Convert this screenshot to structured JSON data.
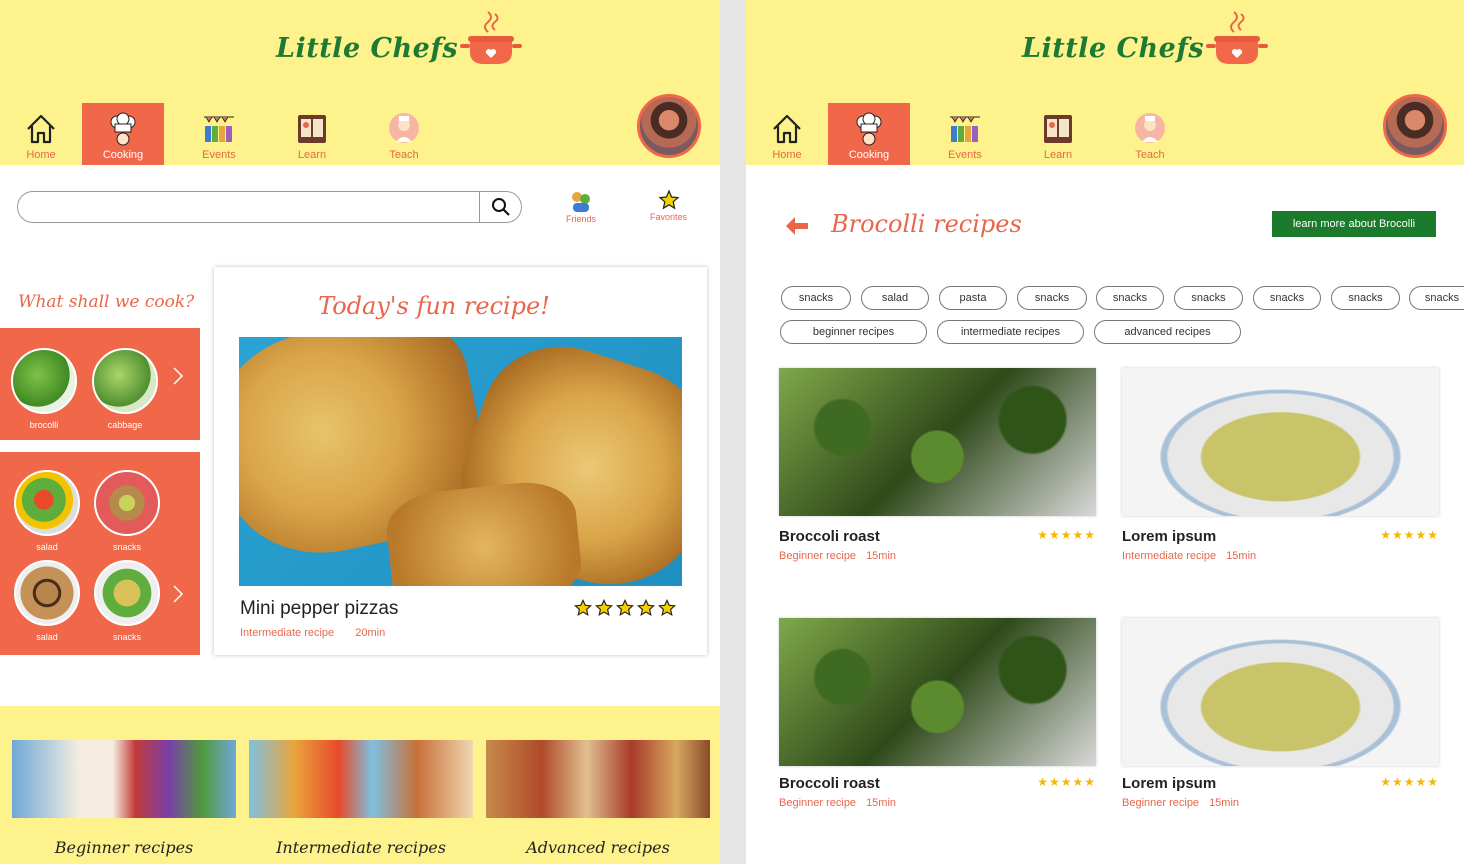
{
  "app": {
    "logo_text": "Little Chefs"
  },
  "nav": {
    "items": [
      {
        "label": "Home",
        "icon": "home-icon"
      },
      {
        "label": "Cooking",
        "icon": "chef-hat-icon",
        "active": true
      },
      {
        "label": "Events",
        "icon": "events-icon"
      },
      {
        "label": "Learn",
        "icon": "book-icon"
      },
      {
        "label": "Teach",
        "icon": "teacher-icon"
      }
    ]
  },
  "left": {
    "search": {
      "placeholder": ""
    },
    "friends_label": "Friends",
    "favorites_label": "Favorites",
    "what_cook": "What shall we cook?",
    "veg": [
      {
        "label": "brocolli"
      },
      {
        "label": "cabbage"
      }
    ],
    "dishes": [
      {
        "label": "salad"
      },
      {
        "label": "snacks"
      },
      {
        "label": "salad"
      },
      {
        "label": "snacks"
      }
    ],
    "today": {
      "title": "Today's fun recipe!",
      "recipe_name": "Mini pepper pizzas",
      "level": "Intermediate recipe",
      "time": "20min",
      "rating": 5
    },
    "levels": [
      {
        "label": "Beginner recipes"
      },
      {
        "label": "Intermediate recipes"
      },
      {
        "label": "Advanced recipes"
      }
    ]
  },
  "right": {
    "title": "Brocolli recipes",
    "learn_button": "learn more about Brocolli",
    "chips_row1": [
      "snacks",
      "salad",
      "pasta",
      "snacks",
      "snacks",
      "snacks",
      "snacks",
      "snacks",
      "snacks"
    ],
    "chips_row2": [
      "beginner recipes",
      "intermediate recipes",
      "advanced recipes"
    ],
    "recipes": [
      {
        "name": "Broccoli roast",
        "level": "Beginner recipe",
        "time": "15min",
        "rating": 5
      },
      {
        "name": "Lorem ipsum",
        "level": "Intermediate recipe",
        "time": "15min",
        "rating": 5
      },
      {
        "name": "Broccoli roast",
        "level": "Beginner recipe",
        "time": "15min",
        "rating": 5
      },
      {
        "name": "Lorem ipsum",
        "level": "Beginner recipe",
        "time": "15min",
        "rating": 5
      }
    ]
  },
  "colors": {
    "header_bg": "#fdf28b",
    "accent": "#f0674a",
    "logo_green": "#1c7a35",
    "button_green": "#1b7a2c",
    "star": "#f5b800"
  }
}
